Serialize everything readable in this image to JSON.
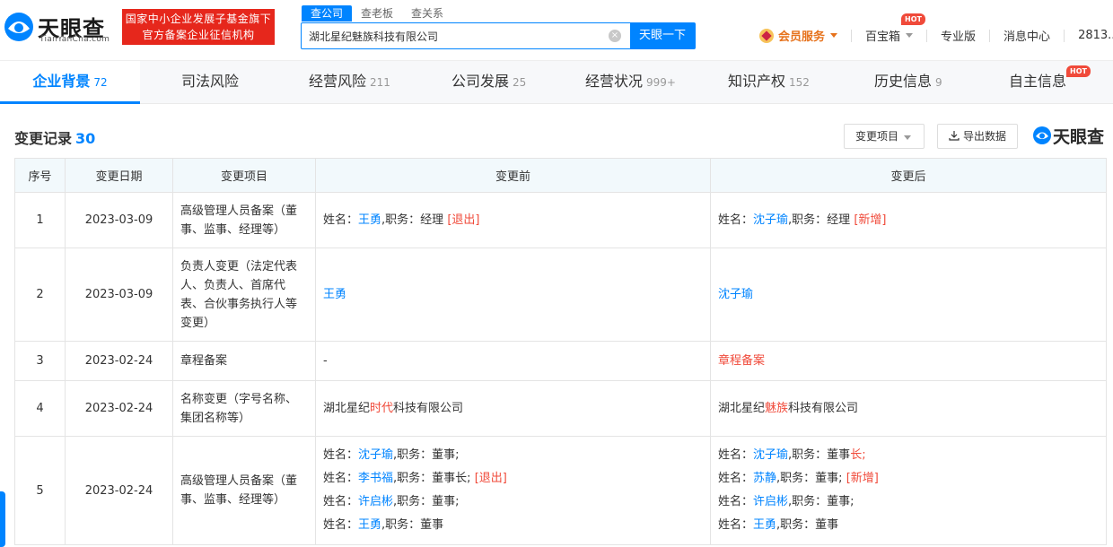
{
  "header": {
    "logo_cn": "天眼查",
    "logo_en": "TianYanCha.com",
    "slogan_line1": "国家中小企业发展子基金旗下",
    "slogan_line2": "官方备案企业征信机构",
    "search_tabs": [
      "查公司",
      "查老板",
      "查关系"
    ],
    "search_value": "湖北星纪魅族科技有限公司",
    "search_button": "天眼一下",
    "vip_label": "会员服务",
    "baobao_label": "百宝箱",
    "hot_badge": "HOT",
    "pro_label": "专业版",
    "msg_label": "消息中心",
    "user_label": "2813..."
  },
  "nav": {
    "tabs": [
      {
        "label": "企业背景",
        "count": "72"
      },
      {
        "label": "司法风险",
        "count": ""
      },
      {
        "label": "经营风险",
        "count": "211"
      },
      {
        "label": "公司发展",
        "count": "25"
      },
      {
        "label": "经营状况",
        "count": "999+"
      },
      {
        "label": "知识产权",
        "count": "152"
      },
      {
        "label": "历史信息",
        "count": "9"
      },
      {
        "label": "自主信息",
        "count": ""
      }
    ],
    "hot_badge": "HOT"
  },
  "section": {
    "title": "变更记录",
    "count": "30",
    "filter_button": "变更项目",
    "export_button": "导出数据",
    "watermark": "天眼查"
  },
  "table": {
    "headers": [
      "序号",
      "变更日期",
      "变更项目",
      "变更前",
      "变更后"
    ],
    "rows": [
      {
        "no": "1",
        "date": "2023-03-09",
        "item": "高级管理人员备案（董事、监事、经理等）"
      },
      {
        "no": "2",
        "date": "2023-03-09",
        "item": "负责人变更（法定代表人、负责人、首席代表、合伙事务执行人等变更）"
      },
      {
        "no": "3",
        "date": "2023-02-24",
        "item": "章程备案"
      },
      {
        "no": "4",
        "date": "2023-02-24",
        "item": "名称变更（字号名称、集团名称等）"
      },
      {
        "no": "5",
        "date": "2023-02-24",
        "item": "高级管理人员备案（董事、监事、经理等）"
      }
    ],
    "labels": {
      "name": "姓名：",
      "duty": ",职务：",
      "manager": "经理",
      "director": "董事",
      "director_sep": "董事;",
      "chairman_sep": "董事长;",
      "chairman_pre": "董事",
      "chairman_suf": "长;",
      "exit": "[退出]",
      "add": "[新增]",
      "dash": "-",
      "charter": "章程备案"
    },
    "people": {
      "wangyong": "王勇",
      "shenziyu": "沈子瑜",
      "lishufu": "李书福",
      "xuqibin": "许启彬",
      "sujing": "苏静"
    },
    "names": {
      "old_prefix": "湖北星纪",
      "old_mid": "时代",
      "old_suffix": "科技有限公司",
      "new_prefix": "湖北星纪",
      "new_mid": "魅族",
      "new_suffix": "科技有限公司"
    }
  },
  "colors": {
    "accent": "#0084ff",
    "red": "#f04a3a",
    "brand_red": "#e6271c",
    "header_bg": "#f2f9fc"
  }
}
